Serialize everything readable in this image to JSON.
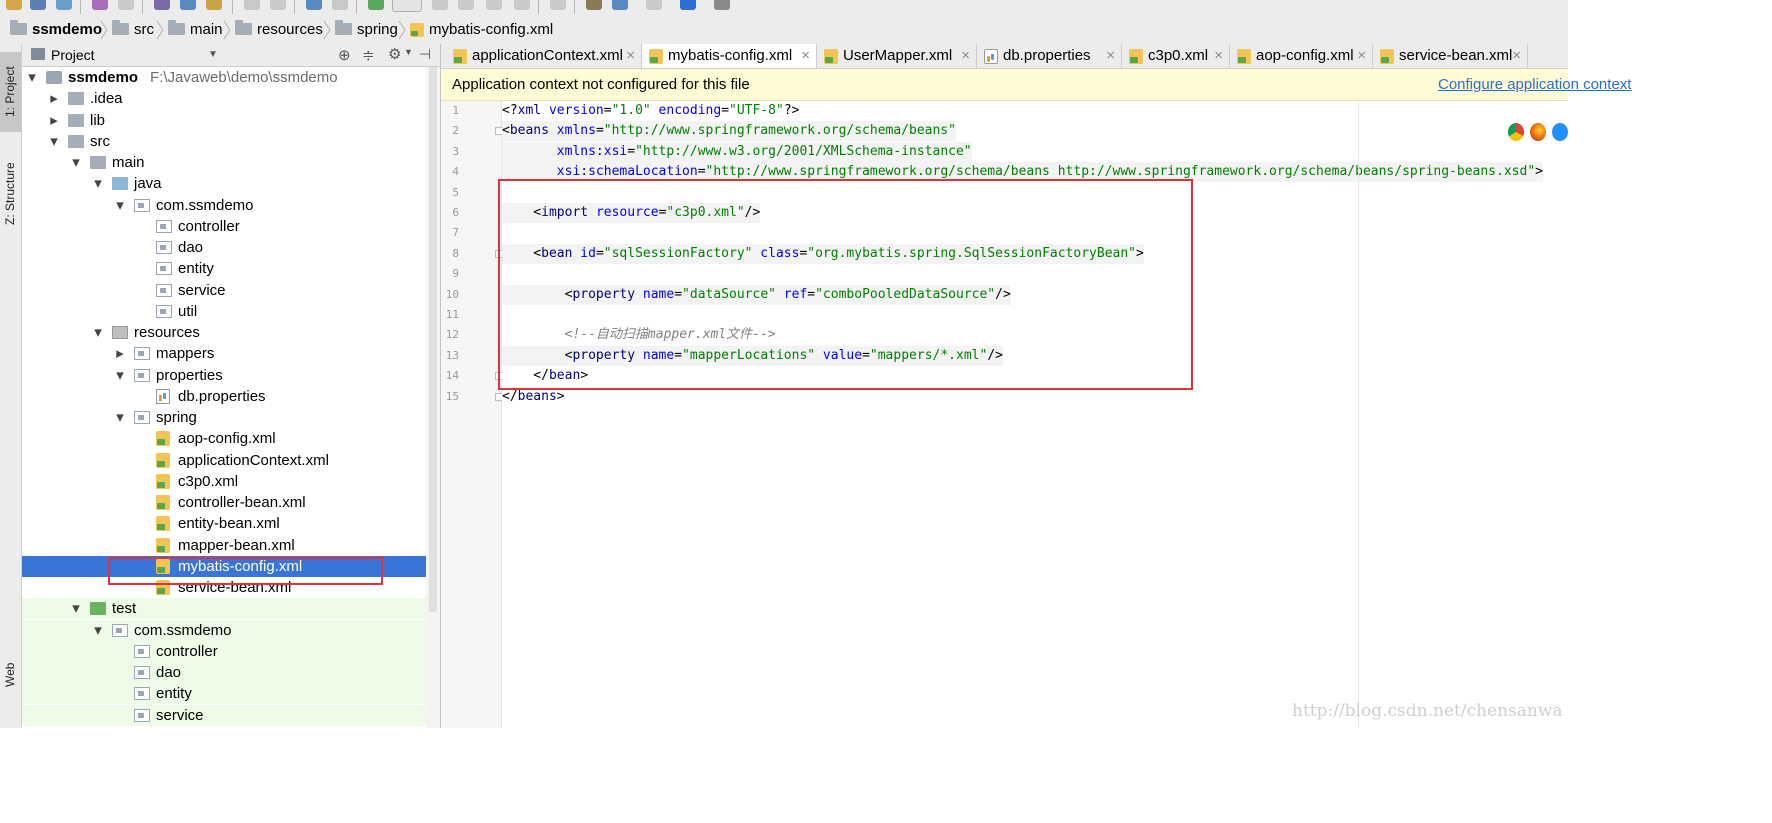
{
  "breadcrumb": [
    {
      "label": "ssmdemo",
      "icon": "module-icon",
      "bold": true
    },
    {
      "label": "src",
      "icon": "folder-icon"
    },
    {
      "label": "main",
      "icon": "folder-icon"
    },
    {
      "label": "resources",
      "icon": "resources-folder-icon"
    },
    {
      "label": "spring",
      "icon": "folder-icon"
    },
    {
      "label": "mybatis-config.xml",
      "icon": "xml-file-icon"
    }
  ],
  "left_strip": {
    "project_tab": "1: Project",
    "structure_tab": "Z: Structure",
    "web_tab": "Web"
  },
  "project_panel": {
    "title": "Project",
    "tree": [
      {
        "label": "ssmdemo",
        "path": "F:\\Javaweb\\demo\\ssmdemo",
        "icon": "module-icon",
        "depth": 0,
        "expanded": true,
        "bold": true
      },
      {
        "label": ".idea",
        "icon": "folder-icon",
        "depth": 1,
        "expanded": false
      },
      {
        "label": "lib",
        "icon": "folder-icon",
        "depth": 1,
        "expanded": false
      },
      {
        "label": "src",
        "icon": "folder-icon",
        "depth": 1,
        "expanded": true
      },
      {
        "label": "main",
        "icon": "folder-icon",
        "depth": 2,
        "expanded": true
      },
      {
        "label": "java",
        "icon": "source-folder-icon",
        "depth": 3,
        "expanded": true
      },
      {
        "label": "com.ssmdemo",
        "icon": "package-icon",
        "depth": 4,
        "expanded": true
      },
      {
        "label": "controller",
        "icon": "package-icon",
        "depth": 5
      },
      {
        "label": "dao",
        "icon": "package-icon",
        "depth": 5
      },
      {
        "label": "entity",
        "icon": "package-icon",
        "depth": 5
      },
      {
        "label": "service",
        "icon": "package-icon",
        "depth": 5
      },
      {
        "label": "util",
        "icon": "package-icon",
        "depth": 5
      },
      {
        "label": "resources",
        "icon": "resources-folder-icon",
        "depth": 3,
        "expanded": true
      },
      {
        "label": "mappers",
        "icon": "package-icon",
        "depth": 4,
        "expanded": false
      },
      {
        "label": "properties",
        "icon": "package-icon",
        "depth": 4,
        "expanded": true
      },
      {
        "label": "db.properties",
        "icon": "properties-file-icon",
        "depth": 5
      },
      {
        "label": "spring",
        "icon": "package-icon",
        "depth": 4,
        "expanded": true
      },
      {
        "label": "aop-config.xml",
        "icon": "xml-file-icon",
        "depth": 5
      },
      {
        "label": "applicationContext.xml",
        "icon": "xml-file-icon",
        "depth": 5
      },
      {
        "label": "c3p0.xml",
        "icon": "xml-file-icon",
        "depth": 5
      },
      {
        "label": "controller-bean.xml",
        "icon": "xml-file-icon",
        "depth": 5
      },
      {
        "label": "entity-bean.xml",
        "icon": "xml-file-icon",
        "depth": 5
      },
      {
        "label": "mapper-bean.xml",
        "icon": "xml-file-icon",
        "depth": 5
      },
      {
        "label": "mybatis-config.xml",
        "icon": "xml-file-icon",
        "depth": 5,
        "selected": true
      },
      {
        "label": "service-bean.xml",
        "icon": "xml-file-icon",
        "depth": 5
      },
      {
        "label": "test",
        "icon": "test-folder-icon",
        "depth": 2,
        "expanded": true,
        "test": true
      },
      {
        "label": "com.ssmdemo",
        "icon": "package-icon",
        "depth": 3,
        "expanded": true,
        "test": true
      },
      {
        "label": "controller",
        "icon": "package-icon",
        "depth": 4,
        "test": true
      },
      {
        "label": "dao",
        "icon": "package-icon",
        "depth": 4,
        "test": true
      },
      {
        "label": "entity",
        "icon": "package-icon",
        "depth": 4,
        "test": true
      },
      {
        "label": "service",
        "icon": "package-icon",
        "depth": 4,
        "test": true
      }
    ]
  },
  "tabs": [
    {
      "label": "applicationContext.xml",
      "icon": "xml-file-icon",
      "active": false
    },
    {
      "label": "mybatis-config.xml",
      "icon": "xml-file-icon",
      "active": true
    },
    {
      "label": "UserMapper.xml",
      "icon": "xml-file-icon",
      "active": false
    },
    {
      "label": "db.properties",
      "icon": "properties-file-icon",
      "active": false
    },
    {
      "label": "c3p0.xml",
      "icon": "xml-file-icon",
      "active": false
    },
    {
      "label": "aop-config.xml",
      "icon": "xml-file-icon",
      "active": false
    },
    {
      "label": "service-bean.xml",
      "icon": "xml-file-icon",
      "active": false
    }
  ],
  "notice": {
    "text": "Application context not configured for this file",
    "link": "Configure application context"
  },
  "editor": {
    "current_line": 11,
    "lines": [
      [
        {
          "t": "<?",
          "c": "k-mark"
        },
        {
          "t": "xml ",
          "c": "k-tag"
        },
        {
          "t": "version",
          "c": "k-attr"
        },
        {
          "t": "=",
          "c": "k-mark"
        },
        {
          "t": "\"1.0\"",
          "c": "k-val"
        },
        {
          "t": " encoding",
          "c": "k-attr"
        },
        {
          "t": "=",
          "c": "k-mark"
        },
        {
          "t": "\"UTF-8\"",
          "c": "k-val"
        },
        {
          "t": "?>",
          "c": "k-mark"
        }
      ],
      [
        {
          "t": "<",
          "c": "k-mark"
        },
        {
          "t": "beans ",
          "c": "k-tag"
        },
        {
          "t": "xmlns",
          "c": "k-attr"
        },
        {
          "t": "=",
          "c": "k-mark"
        },
        {
          "t": "\"http://www.springframework.org/schema/beans\"",
          "c": "k-val"
        }
      ],
      [
        {
          "t": "       ",
          "c": "k-mark"
        },
        {
          "t": "xmlns:xsi",
          "c": "k-attr"
        },
        {
          "t": "=",
          "c": "k-mark"
        },
        {
          "t": "\"http://www.w3.org/2001/XMLSchema-instance\"",
          "c": "k-val"
        }
      ],
      [
        {
          "t": "       ",
          "c": "k-mark"
        },
        {
          "t": "xsi:schemaLocation",
          "c": "k-attr"
        },
        {
          "t": "=",
          "c": "k-mark"
        },
        {
          "t": "\"http://www.springframework.org/schema/beans http://www.springframework.org/schema/beans/spring-beans.xsd\"",
          "c": "k-val"
        },
        {
          "t": ">",
          "c": "k-mark"
        }
      ],
      [],
      [
        {
          "t": "    <",
          "c": "k-mark"
        },
        {
          "t": "import ",
          "c": "k-tag"
        },
        {
          "t": "resource",
          "c": "k-attr"
        },
        {
          "t": "=",
          "c": "k-mark"
        },
        {
          "t": "\"c3p0.xml\"",
          "c": "k-val"
        },
        {
          "t": "/>",
          "c": "k-mark"
        }
      ],
      [],
      [
        {
          "t": "    <",
          "c": "k-mark"
        },
        {
          "t": "bean ",
          "c": "k-tag"
        },
        {
          "t": "id",
          "c": "k-attr"
        },
        {
          "t": "=",
          "c": "k-mark"
        },
        {
          "t": "\"sqlSessionFactory\"",
          "c": "k-val"
        },
        {
          "t": " class",
          "c": "k-attr"
        },
        {
          "t": "=",
          "c": "k-mark"
        },
        {
          "t": "\"org.mybatis.spring.SqlSessionFactoryBean\"",
          "c": "k-val"
        },
        {
          "t": ">",
          "c": "k-mark"
        }
      ],
      [],
      [
        {
          "t": "        <",
          "c": "k-mark"
        },
        {
          "t": "property ",
          "c": "k-tag"
        },
        {
          "t": "name",
          "c": "k-attr"
        },
        {
          "t": "=",
          "c": "k-mark"
        },
        {
          "t": "\"dataSource\"",
          "c": "k-val"
        },
        {
          "t": " ref",
          "c": "k-attr"
        },
        {
          "t": "=",
          "c": "k-mark"
        },
        {
          "t": "\"comboPooledDataSource\"",
          "c": "k-val"
        },
        {
          "t": "/>",
          "c": "k-mark"
        }
      ],
      [],
      [
        {
          "t": "        <!--自动扫描mapper.xml文件-->",
          "c": "k-cmt"
        }
      ],
      [
        {
          "t": "        <",
          "c": "k-mark"
        },
        {
          "t": "property ",
          "c": "k-tag"
        },
        {
          "t": "name",
          "c": "k-attr"
        },
        {
          "t": "=",
          "c": "k-mark"
        },
        {
          "t": "\"mapperLocations\"",
          "c": "k-val"
        },
        {
          "t": " value",
          "c": "k-attr"
        },
        {
          "t": "=",
          "c": "k-mark"
        },
        {
          "t": "\"mappers/*.xml\"",
          "c": "k-val"
        },
        {
          "t": "/>",
          "c": "k-mark"
        }
      ],
      [
        {
          "t": "    </",
          "c": "k-mark"
        },
        {
          "t": "bean",
          "c": "k-tag"
        },
        {
          "t": ">",
          "c": "k-mark"
        }
      ],
      [
        {
          "t": "</",
          "c": "k-mark"
        },
        {
          "t": "beans",
          "c": "k-tag"
        },
        {
          "t": ">",
          "c": "k-mark"
        }
      ]
    ]
  },
  "watermark": "http://blog.csdn.net/chensanwa",
  "colors": {
    "selection": "#3875d7",
    "annotation_red": "#e0323a",
    "notice_bg": "#fffbd4"
  }
}
